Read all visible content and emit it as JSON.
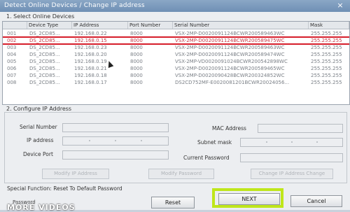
{
  "window": {
    "title": "Detect Online Devices / Change IP address",
    "close_label": "×"
  },
  "section1": "1. Select Online Devices",
  "table": {
    "headers": [
      "",
      "Device Type",
      "IP Address",
      "Port Number",
      "Serial Number",
      "Mask"
    ],
    "rows": [
      [
        "001",
        "DS_2CD85...",
        "192.168.0.22",
        "8000",
        "VSX-2MP-D0020091124BCWR200589463WC",
        "255.255.255"
      ],
      [
        "002",
        "DS_2CD85...",
        "192.168.0.15",
        "8000",
        "VSX-2MP-D0020091124BCWR200589475WC",
        "255.255.255"
      ],
      [
        "003",
        "DS_2CD85...",
        "192.168.0.23",
        "8000",
        "VSX-2MP-D0020091124BCWR200589463WC",
        "255.255.255"
      ],
      [
        "004",
        "DS_2CD85...",
        "192.168.0.20",
        "8000",
        "VSX-2MP-D0020091124BCWR200589474WC",
        "255.255.255"
      ],
      [
        "005",
        "DS_2CD85...",
        "192.168.0.19",
        "8000",
        "VSX-2MP-VD0020091024BCWR200542898WC",
        "255.255.255"
      ],
      [
        "006",
        "DS_2CD85...",
        "192.168.0.21",
        "8000",
        "VSX-2MP-D0020091124BCWR200589465WC",
        "255.255.255"
      ],
      [
        "007",
        "DS_2CD85...",
        "192.168.0.18",
        "8000",
        "VSX-2MP-D0020090428BCWR200324852WC",
        "255.255.255"
      ],
      [
        "008",
        "DS_2CD85...",
        "192.168.0.17",
        "8000",
        "DS2CD752MF-E0020081201BCWR20024056...",
        "255.255.255"
      ]
    ],
    "selected_row": 1
  },
  "section2": "2. Configure IP Address",
  "form": {
    "serial_number": "Serial Number",
    "ip_address": "IP address",
    "device_port": "Device Port",
    "mac_address": "MAC Address",
    "subnet_mask": "Subnet mask",
    "current_password": "Current Password",
    "modify_ip": "Modify IP Address",
    "modify_password": "Modify Password",
    "change_ip_address": "Change IP Address Change"
  },
  "special_function": "Special Function: Reset To Default Password",
  "password_label": "Password",
  "overlay_text": "MORE VIDEOS",
  "buttons": {
    "reset": "Reset",
    "next": "NEXT",
    "cancel": "Cancel"
  },
  "colors": {
    "selection": "#d61e2b",
    "highlight": "#bfe61a",
    "titlebar": "#7393b8"
  }
}
